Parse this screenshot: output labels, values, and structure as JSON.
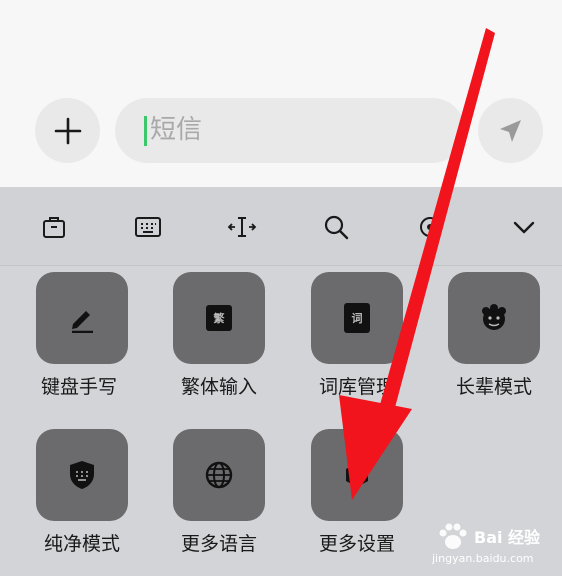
{
  "compose": {
    "placeholder": "短信"
  },
  "keyboard": {
    "toolbar_icons": [
      "clipboard-icon",
      "keyboard-icon",
      "cursor-move-icon",
      "search-icon",
      "settings-icon",
      "collapse-chevron-icon"
    ],
    "tiles": [
      {
        "label": "键盘手写",
        "icon": "pencil-icon",
        "glyph": ""
      },
      {
        "label": "繁体输入",
        "icon": "traditional-chinese-icon",
        "glyph": "繁"
      },
      {
        "label": "词库管理",
        "icon": "dictionary-icon",
        "glyph": "词"
      },
      {
        "label": "长辈模式",
        "icon": "elder-face-icon",
        "glyph": ""
      },
      {
        "label": "纯净模式",
        "icon": "shield-keyboard-icon",
        "glyph": ""
      },
      {
        "label": "更多语言",
        "icon": "globe-icon",
        "glyph": ""
      },
      {
        "label": "更多设置",
        "icon": "hex-nut-icon",
        "glyph": ""
      }
    ]
  },
  "watermark": {
    "brand": "Bai 经验",
    "url": "jingyan.baidu.com"
  },
  "colors": {
    "arrow": "#f2141c",
    "tile": "#6b6b6d",
    "keyboard_bg": "#d3d4d8",
    "caret": "#3cc86a"
  }
}
